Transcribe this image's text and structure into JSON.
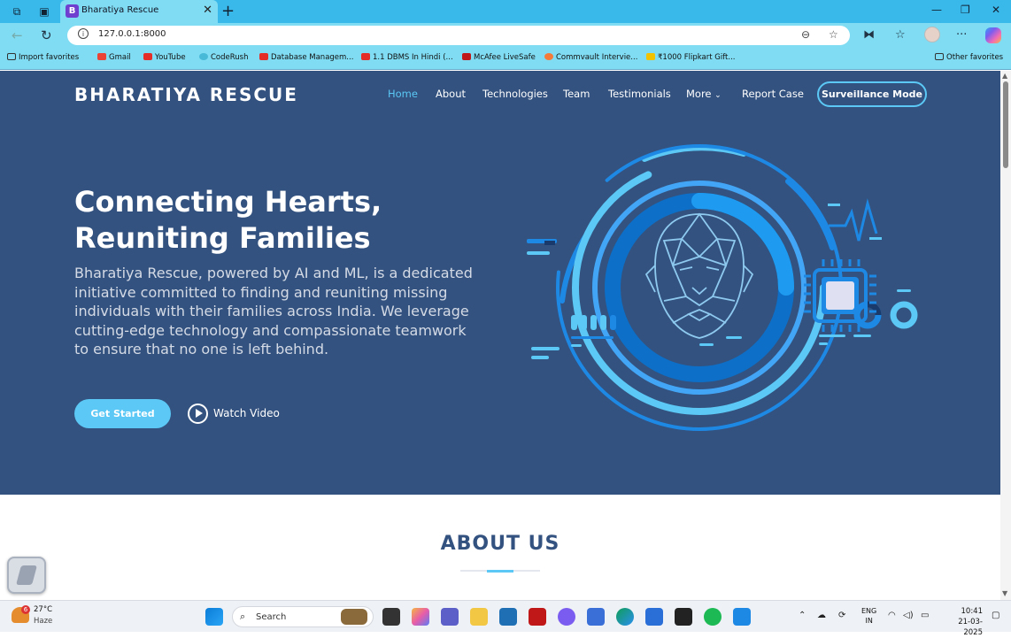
{
  "browser": {
    "tab_title": "Bharatiya Rescue",
    "tab_icon_letter": "B",
    "url": "127.0.0.1:8000",
    "bookmarks": [
      "Import favorites",
      "Gmail",
      "YouTube",
      "CodeRush",
      "Database Managem...",
      "1.1 DBMS In Hindi (...",
      "McAfee LiveSafe",
      "Commvault Intervie...",
      "₹1000 Flipkart Gift..."
    ],
    "other_favorites": "Other favorites"
  },
  "site": {
    "brand": "BHARATIYA RESCUE",
    "nav": [
      "Home",
      "About",
      "Technologies",
      "Team",
      "Testimonials",
      "More",
      "Report Case"
    ],
    "surveillance_button": "Surveillance Mode",
    "hero_title_line1": "Connecting Hearts,",
    "hero_title_line2": "Reuniting Families",
    "hero_text": "Bharatiya Rescue, powered by AI and ML, is a dedicated initiative committed to finding and reuniting missing individuals with their families across India. We leverage cutting-edge technology and compassionate teamwork to ensure that no one is left behind.",
    "get_started": "Get Started",
    "watch_video": "Watch Video",
    "about_heading": "ABOUT US"
  },
  "colors": {
    "hero_bg": "#33527f",
    "accent": "#5bc8f5",
    "browser_chrome": "#7fdcf2"
  },
  "taskbar": {
    "weather_temp": "27°C",
    "weather_desc": "Haze",
    "weather_badge": "6",
    "search_placeholder": "Search",
    "lang_line1": "ENG",
    "lang_line2": "IN",
    "time": "10:41",
    "date": "21-03-2025"
  }
}
